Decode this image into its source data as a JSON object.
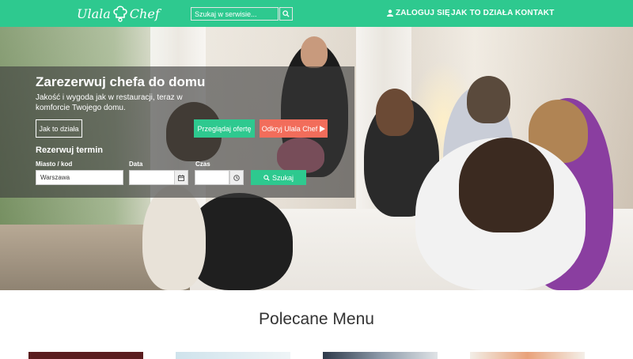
{
  "navbar": {
    "logo_text_left": "Ulala",
    "logo_text_right": "Chef",
    "search_placeholder": "Szukaj w serwisie...",
    "search_icon": "search-icon",
    "login_label": "ZALOGUJ SIĘ",
    "login_icon": "user-icon",
    "how_label": "JAK TO DZIAŁA",
    "contact_label": "KONTAKT",
    "accent_color": "#2ec98f"
  },
  "hero": {
    "title": "Zarezerwuj chefa do domu",
    "subtitle": "Jakość i wygoda jak w restauracji, teraz w komforcie Twojego domu.",
    "how_button": "Jak to działa",
    "offer_button": "Przeglądaj ofertę",
    "discover_button": "Odkryj Ulala Chef",
    "discover_icon": "play-icon",
    "discover_color": "#f26d5b"
  },
  "reservation": {
    "title": "Rezerwuj termin",
    "city_label": "Miasto / kod",
    "city_value": "Warszawa",
    "date_label": "Data",
    "date_value": "",
    "date_icon": "calendar-icon",
    "time_label": "Czas",
    "time_value": "",
    "time_icon": "clock-icon",
    "search_button": "Szukaj",
    "search_icon": "search-icon"
  },
  "featured": {
    "title": "Polecane Menu"
  }
}
